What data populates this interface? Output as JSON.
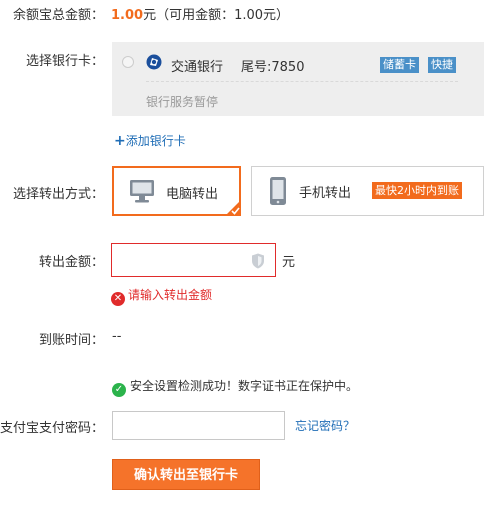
{
  "balance": {
    "label": "余额宝总金额：",
    "amount": "1.00",
    "suffix": "元（可用金额：1.00元）"
  },
  "bank_card": {
    "label": "选择银行卡：",
    "bank_name": "交通银行",
    "tail_number": "尾号:7850",
    "tags": [
      "储蓄卡",
      "快捷"
    ],
    "note": "银行服务暂停",
    "add_card": "添加银行卡",
    "add_card_plus": "+"
  },
  "transfer_method": {
    "label": "选择转出方式：",
    "options": [
      {
        "label": "电脑转出",
        "selected": true
      },
      {
        "label": "手机转出",
        "selected": false,
        "badge": "最快2小时内到账"
      }
    ]
  },
  "amount": {
    "label": "转出金额：",
    "value": "",
    "unit": "元",
    "error": "请输入转出金额"
  },
  "arrival": {
    "label": "到账时间：",
    "value": "--"
  },
  "security": {
    "message": "安全设置检测成功！数字证书正在保护中。"
  },
  "password": {
    "label": "支付宝支付密码：",
    "value": "",
    "forgot_link": "忘记密码？"
  },
  "confirm_button": "确认转出至银行卡",
  "colors": {
    "accent_orange": "#f26b1d",
    "link_blue": "#1f6db6",
    "error_red": "#e02b2b",
    "success_green": "#2bb34b",
    "tag_blue": "#4a90c8"
  }
}
